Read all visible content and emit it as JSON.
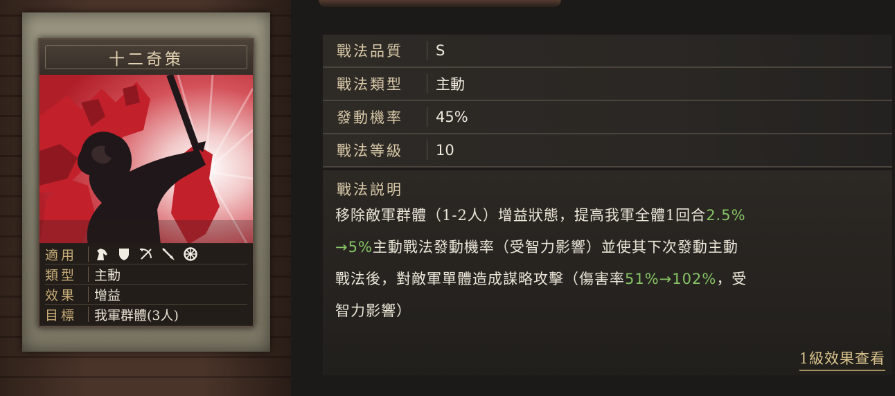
{
  "card": {
    "title": "十二奇策",
    "stats": [
      {
        "key": "適用",
        "value": ""
      },
      {
        "key": "類型",
        "value": "主動"
      },
      {
        "key": "效果",
        "value": "增益"
      },
      {
        "key": "目標",
        "value": "我軍群體(3人)"
      }
    ],
    "applicable_icons": [
      "cavalry-horse-icon",
      "shield-infantry-icon",
      "archer-bow-icon",
      "spear-icon",
      "chariot-wheel-icon"
    ]
  },
  "attributes": [
    {
      "key": "戰法品質",
      "value": "S"
    },
    {
      "key": "戰法類型",
      "value": "主動"
    },
    {
      "key": "發動機率",
      "value": "45%"
    },
    {
      "key": "戰法等級",
      "value": "10"
    }
  ],
  "description": {
    "title": "戰法説明",
    "line1_a": "移除敵軍群體（1-2人）增益狀態，提高我軍全體1回合",
    "line1_hl": "2.5%",
    "line2_hl": "→5%",
    "line2_a": "主動戰法發動機率（受智力影響）並使其下次發動主動",
    "line3_a": "戰法後，對敵軍單體造成謀略攻擊（傷害率",
    "line3_hl": "51%→102%",
    "line3_b": "，受",
    "line4_a": "智力影響）"
  },
  "link_label": "1級效果查看",
  "colors": {
    "highlight": "#86c465",
    "gold_label": "#c7ac77",
    "art_red": "#c0202a"
  }
}
